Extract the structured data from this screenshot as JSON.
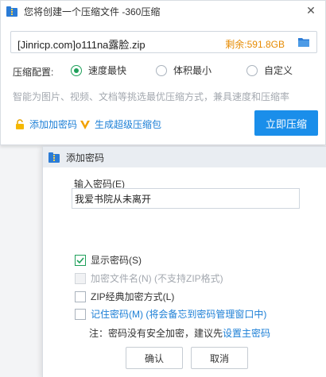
{
  "main_window": {
    "title": "您将创建一个压缩文件 -360压缩",
    "close_glyph": "✕",
    "filename": "[Jinricp.com]o111na露脸.zip",
    "free_space": "剩余:591.8GB",
    "config_label": "压缩配置:",
    "options": [
      {
        "label": "速度最快",
        "selected": true
      },
      {
        "label": "体积最小",
        "selected": false
      },
      {
        "label": "自定义",
        "selected": false
      }
    ],
    "hint": "智能为图片、视频、文档等挑选最优压缩方式，兼具速度和压缩率",
    "add_password": "添加加密码",
    "sfx_link": "生成超级压缩包",
    "compress_button": "立即压缩"
  },
  "dialog": {
    "title": "添加密码",
    "password_label": "输入密码(E)",
    "password_value": "我爱书院从未离开",
    "checkboxes": [
      {
        "label": "显示密码(S)",
        "checked": true,
        "disabled": false
      },
      {
        "label": "加密文件名(N) (不支持ZIP格式)",
        "checked": false,
        "disabled": true
      },
      {
        "label": "ZIP经典加密方式(L)",
        "checked": false,
        "disabled": false
      },
      {
        "label": "记住密码(M) (将会备忘到密码管理窗口中)",
        "checked": false,
        "disabled": false
      }
    ],
    "note_prefix": "注：密码没有安全加密，建议先",
    "note_link": "设置主密码",
    "ok_button": "确认",
    "cancel_button": "取消"
  },
  "colors": {
    "accent_blue": "#1a8eea",
    "link_blue": "#1c7fd6",
    "check_green": "#1fa05a",
    "space_orange": "#e68a00"
  },
  "icons": [
    "zip-app-icon",
    "close-icon",
    "folder-icon",
    "lock-icon",
    "v-sfx-icon",
    "check-icon"
  ]
}
